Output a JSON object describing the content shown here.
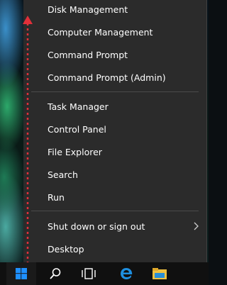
{
  "menu": {
    "items": [
      {
        "label": "Disk Management"
      },
      {
        "label": "Computer Management"
      },
      {
        "label": "Command Prompt"
      },
      {
        "label": "Command Prompt (Admin)"
      },
      {
        "label": "Task Manager"
      },
      {
        "label": "Control Panel"
      },
      {
        "label": "File Explorer"
      },
      {
        "label": "Search"
      },
      {
        "label": "Run"
      },
      {
        "label": "Shut down or sign out"
      },
      {
        "label": "Desktop"
      }
    ]
  },
  "taskbar": {
    "buttons": [
      {
        "icon": "windows-logo-icon"
      },
      {
        "icon": "search-icon"
      },
      {
        "icon": "task-view-icon"
      },
      {
        "icon": "edge-icon"
      },
      {
        "icon": "file-explorer-icon"
      }
    ]
  },
  "colors": {
    "menu_bg": "#2b2b2b",
    "text": "#ffffff",
    "accent_blue": "#1e90ff",
    "annotation_red": "#e0303a"
  }
}
